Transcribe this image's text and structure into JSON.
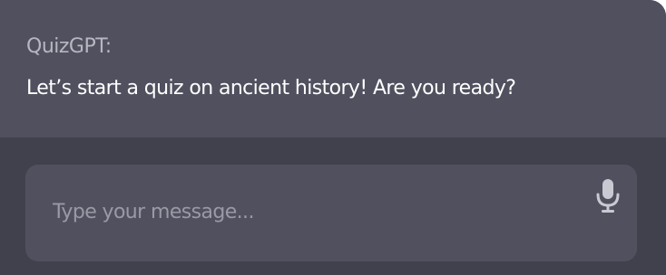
{
  "conversation": {
    "sender": "QuizGPT:",
    "message": "Let’s start a quiz on ancient history! Are you ready?"
  },
  "composer": {
    "placeholder": "Type your message...",
    "mic_icon": "microphone-icon"
  },
  "colors": {
    "background": "#41414d",
    "panel": "#50505f",
    "sender_text": "#b7b7c2",
    "message_text": "#ffffff",
    "placeholder_text": "#9a9aa6",
    "icon": "#c9c9d3"
  }
}
